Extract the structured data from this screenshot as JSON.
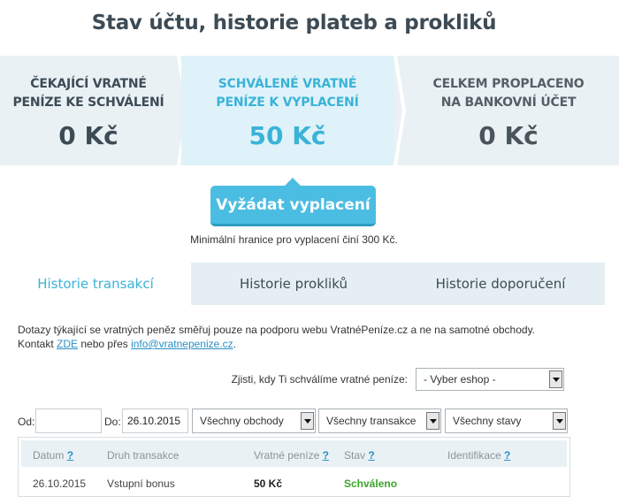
{
  "page": {
    "title": "Stav účtu, historie plateb a prokliků"
  },
  "stats": [
    {
      "label_1": "ČEKAJÍCÍ VRATNÉ",
      "label_2": "PENÍZE KE SCHVÁLENÍ",
      "value": "0 Kč"
    },
    {
      "label_1": "SCHVÁLENÉ VRATNÉ",
      "label_2": "PENÍZE K VYPLACENÍ",
      "value": "50 Kč"
    },
    {
      "label_1": "CELKEM PROPLACENO",
      "label_2": "NA BANKOVNÍ ÚČET",
      "value": "0 Kč"
    }
  ],
  "payout": {
    "button_label": "Vyžádat vyplacení",
    "note": "Minimální hranice pro vyplacení činí 300 Kč."
  },
  "tabs": [
    {
      "label": "Historie transakcí",
      "active": true
    },
    {
      "label": "Historie prokliků",
      "active": false
    },
    {
      "label": "Historie doporučení",
      "active": false
    }
  ],
  "notice": {
    "line1": "Dotazy týkající se vratných peněz směřuj pouze na podporu webu VratnéPeníze.cz a ne na samotné obchody.",
    "line2_prefix": "Kontakt ",
    "zde_link": "ZDE",
    "line2_middle": " nebo přes ",
    "email_link": "info@vratnepenize.cz",
    "line2_suffix": "."
  },
  "eshop_filter": {
    "label": "Zjisti, kdy Ti schválíme vratné peníze:",
    "selected": "- Vyber eshop -"
  },
  "filters": {
    "from_label": "Od:",
    "from_value": "",
    "to_label": "Do:",
    "to_value": "26.10.2015",
    "shops_selected": "Všechny obchody",
    "transactions_selected": "Všechny transakce",
    "states_selected": "Všechny stavy"
  },
  "table": {
    "headers": {
      "date": "Datum",
      "type": "Druh transakce",
      "amount": "Vratné peníze",
      "state": "Stav",
      "ident": "Identifikace",
      "help": "?"
    },
    "rows": [
      {
        "date": "26.10.2015",
        "type": "Vstupní bonus",
        "amount": "50 Kč",
        "state": "Schváleno",
        "ident": ""
      }
    ]
  },
  "colors": {
    "accent": "#3ab3d8",
    "button": "#4cbde2",
    "approved": "#3aa52a",
    "link": "#2a8fc5"
  },
  "icons": [
    "chevron-right-icon",
    "select-arrow-icon"
  ]
}
